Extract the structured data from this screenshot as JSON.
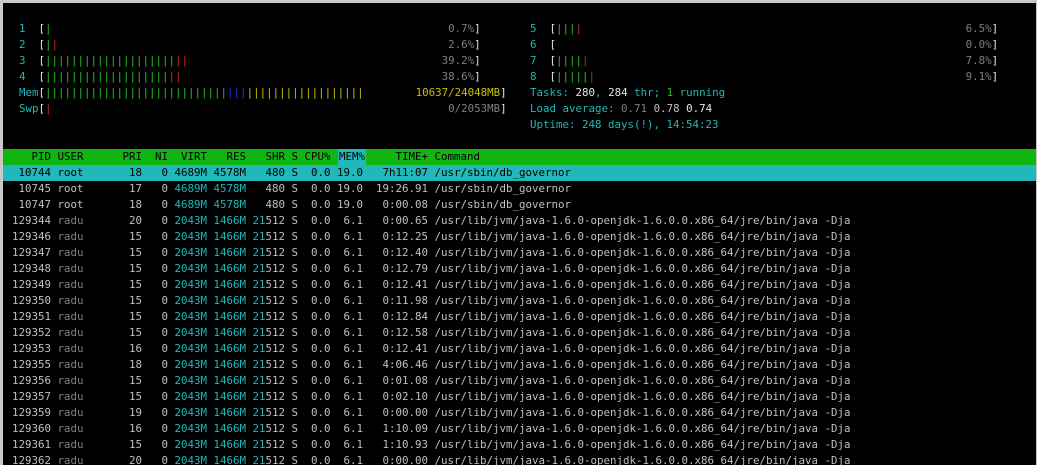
{
  "cpus": [
    {
      "id": "1",
      "bars": [
        {
          "c": "g",
          "n": 1
        }
      ],
      "pct": "0.7%"
    },
    {
      "id": "2",
      "bars": [
        {
          "c": "g",
          "n": 1
        },
        {
          "c": "r",
          "n": 1
        }
      ],
      "pct": "2.6%"
    },
    {
      "id": "3",
      "bars": [
        {
          "c": "g",
          "n": 20
        },
        {
          "c": "r",
          "n": 2
        }
      ],
      "pct": "39.2%"
    },
    {
      "id": "4",
      "bars": [
        {
          "c": "g",
          "n": 19
        },
        {
          "c": "r",
          "n": 2
        }
      ],
      "pct": "38.6%"
    },
    {
      "id": "5",
      "bars": [
        {
          "c": "g",
          "n": 3
        },
        {
          "c": "r",
          "n": 1
        }
      ],
      "pct": "6.5%"
    },
    {
      "id": "6",
      "bars": [],
      "pct": "0.0%"
    },
    {
      "id": "7",
      "bars": [
        {
          "c": "g",
          "n": 4
        },
        {
          "c": "r",
          "n": 1
        }
      ],
      "pct": "7.8%"
    },
    {
      "id": "8",
      "bars": [
        {
          "c": "g",
          "n": 5
        },
        {
          "c": "r",
          "n": 1
        }
      ],
      "pct": "9.1%"
    }
  ],
  "mem": {
    "label": "Mem",
    "bars": [
      {
        "c": "g",
        "n": 28
      },
      {
        "c": "bl",
        "n": 3
      },
      {
        "c": "ye",
        "n": 18
      }
    ],
    "value": "10637/24048MB"
  },
  "swp": {
    "label": "Swp",
    "bars": [
      {
        "c": "r",
        "n": 1
      }
    ],
    "value": "0/2053MB"
  },
  "tasks": {
    "label": "Tasks:",
    "count": "280",
    "thr": "284",
    "running": "1"
  },
  "load": {
    "label": "Load average:",
    "l1": "0.71",
    "l5": "0.78",
    "l15": "0.74"
  },
  "uptime": {
    "label": "Uptime:",
    "value": "248 days(!), 14:54:23"
  },
  "columns": {
    "pid": "PID",
    "user": "USER",
    "pri": "PRI",
    "ni": "NI",
    "virt": "VIRT",
    "res": "RES",
    "shr": "SHR",
    "s": "S",
    "cpu": "CPU%",
    "mem": "MEM%",
    "time": "TIME+",
    "cmd": "Command"
  },
  "processes": [
    {
      "pid": "10744",
      "user": "root",
      "pri": "18",
      "ni": "0",
      "virt": "4689M",
      "res": "4578M",
      "shr": "480",
      "s": "S",
      "cpu": "0.0",
      "mem": "19.0",
      "time": "7h11:07",
      "cmd": "/usr/sbin/db_governor"
    },
    {
      "pid": "10745",
      "user": "root",
      "pri": "17",
      "ni": "0",
      "virt": "4689M",
      "res": "4578M",
      "shr": "480",
      "s": "S",
      "cpu": "0.0",
      "mem": "19.0",
      "time": "19:26.91",
      "cmd": "/usr/sbin/db_governor"
    },
    {
      "pid": "10747",
      "user": "root",
      "pri": "18",
      "ni": "0",
      "virt": "4689M",
      "res": "4578M",
      "shr": "480",
      "s": "S",
      "cpu": "0.0",
      "mem": "19.0",
      "time": "0:00.08",
      "cmd": "/usr/sbin/db_governor"
    },
    {
      "pid": "129344",
      "user": "radu",
      "pri": "20",
      "ni": "0",
      "virt": "2043M",
      "res": "1466M",
      "shr": "21512",
      "s": "S",
      "cpu": "0.0",
      "mem": "6.1",
      "time": "0:00.65",
      "cmd": "/usr/lib/jvm/java-1.6.0-openjdk-1.6.0.0.x86_64/jre/bin/java -Dja"
    },
    {
      "pid": "129346",
      "user": "radu",
      "pri": "15",
      "ni": "0",
      "virt": "2043M",
      "res": "1466M",
      "shr": "21512",
      "s": "S",
      "cpu": "0.0",
      "mem": "6.1",
      "time": "0:12.25",
      "cmd": "/usr/lib/jvm/java-1.6.0-openjdk-1.6.0.0.x86_64/jre/bin/java -Dja"
    },
    {
      "pid": "129347",
      "user": "radu",
      "pri": "15",
      "ni": "0",
      "virt": "2043M",
      "res": "1466M",
      "shr": "21512",
      "s": "S",
      "cpu": "0.0",
      "mem": "6.1",
      "time": "0:12.40",
      "cmd": "/usr/lib/jvm/java-1.6.0-openjdk-1.6.0.0.x86_64/jre/bin/java -Dja"
    },
    {
      "pid": "129348",
      "user": "radu",
      "pri": "15",
      "ni": "0",
      "virt": "2043M",
      "res": "1466M",
      "shr": "21512",
      "s": "S",
      "cpu": "0.0",
      "mem": "6.1",
      "time": "0:12.79",
      "cmd": "/usr/lib/jvm/java-1.6.0-openjdk-1.6.0.0.x86_64/jre/bin/java -Dja"
    },
    {
      "pid": "129349",
      "user": "radu",
      "pri": "15",
      "ni": "0",
      "virt": "2043M",
      "res": "1466M",
      "shr": "21512",
      "s": "S",
      "cpu": "0.0",
      "mem": "6.1",
      "time": "0:12.41",
      "cmd": "/usr/lib/jvm/java-1.6.0-openjdk-1.6.0.0.x86_64/jre/bin/java -Dja"
    },
    {
      "pid": "129350",
      "user": "radu",
      "pri": "15",
      "ni": "0",
      "virt": "2043M",
      "res": "1466M",
      "shr": "21512",
      "s": "S",
      "cpu": "0.0",
      "mem": "6.1",
      "time": "0:11.98",
      "cmd": "/usr/lib/jvm/java-1.6.0-openjdk-1.6.0.0.x86_64/jre/bin/java -Dja"
    },
    {
      "pid": "129351",
      "user": "radu",
      "pri": "15",
      "ni": "0",
      "virt": "2043M",
      "res": "1466M",
      "shr": "21512",
      "s": "S",
      "cpu": "0.0",
      "mem": "6.1",
      "time": "0:12.84",
      "cmd": "/usr/lib/jvm/java-1.6.0-openjdk-1.6.0.0.x86_64/jre/bin/java -Dja"
    },
    {
      "pid": "129352",
      "user": "radu",
      "pri": "15",
      "ni": "0",
      "virt": "2043M",
      "res": "1466M",
      "shr": "21512",
      "s": "S",
      "cpu": "0.0",
      "mem": "6.1",
      "time": "0:12.58",
      "cmd": "/usr/lib/jvm/java-1.6.0-openjdk-1.6.0.0.x86_64/jre/bin/java -Dja"
    },
    {
      "pid": "129353",
      "user": "radu",
      "pri": "16",
      "ni": "0",
      "virt": "2043M",
      "res": "1466M",
      "shr": "21512",
      "s": "S",
      "cpu": "0.0",
      "mem": "6.1",
      "time": "0:12.41",
      "cmd": "/usr/lib/jvm/java-1.6.0-openjdk-1.6.0.0.x86_64/jre/bin/java -Dja"
    },
    {
      "pid": "129355",
      "user": "radu",
      "pri": "18",
      "ni": "0",
      "virt": "2043M",
      "res": "1466M",
      "shr": "21512",
      "s": "S",
      "cpu": "0.0",
      "mem": "6.1",
      "time": "4:06.46",
      "cmd": "/usr/lib/jvm/java-1.6.0-openjdk-1.6.0.0.x86_64/jre/bin/java -Dja"
    },
    {
      "pid": "129356",
      "user": "radu",
      "pri": "15",
      "ni": "0",
      "virt": "2043M",
      "res": "1466M",
      "shr": "21512",
      "s": "S",
      "cpu": "0.0",
      "mem": "6.1",
      "time": "0:01.08",
      "cmd": "/usr/lib/jvm/java-1.6.0-openjdk-1.6.0.0.x86_64/jre/bin/java -Dja"
    },
    {
      "pid": "129357",
      "user": "radu",
      "pri": "15",
      "ni": "0",
      "virt": "2043M",
      "res": "1466M",
      "shr": "21512",
      "s": "S",
      "cpu": "0.0",
      "mem": "6.1",
      "time": "0:02.10",
      "cmd": "/usr/lib/jvm/java-1.6.0-openjdk-1.6.0.0.x86_64/jre/bin/java -Dja"
    },
    {
      "pid": "129359",
      "user": "radu",
      "pri": "19",
      "ni": "0",
      "virt": "2043M",
      "res": "1466M",
      "shr": "21512",
      "s": "S",
      "cpu": "0.0",
      "mem": "6.1",
      "time": "0:00.00",
      "cmd": "/usr/lib/jvm/java-1.6.0-openjdk-1.6.0.0.x86_64/jre/bin/java -Dja"
    },
    {
      "pid": "129360",
      "user": "radu",
      "pri": "16",
      "ni": "0",
      "virt": "2043M",
      "res": "1466M",
      "shr": "21512",
      "s": "S",
      "cpu": "0.0",
      "mem": "6.1",
      "time": "1:10.09",
      "cmd": "/usr/lib/jvm/java-1.6.0-openjdk-1.6.0.0.x86_64/jre/bin/java -Dja"
    },
    {
      "pid": "129361",
      "user": "radu",
      "pri": "15",
      "ni": "0",
      "virt": "2043M",
      "res": "1466M",
      "shr": "21512",
      "s": "S",
      "cpu": "0.0",
      "mem": "6.1",
      "time": "1:10.93",
      "cmd": "/usr/lib/jvm/java-1.6.0-openjdk-1.6.0.0.x86_64/jre/bin/java -Dja"
    },
    {
      "pid": "129362",
      "user": "radu",
      "pri": "20",
      "ni": "0",
      "virt": "2043M",
      "res": "1466M",
      "shr": "21512",
      "s": "S",
      "cpu": "0.0",
      "mem": "6.1",
      "time": "0:00.00",
      "cmd": "/usr/lib/jvm/java-1.6.0-openjdk-1.6.0.0.x86_64/jre/bin/java -Dja"
    }
  ],
  "selected_index": 0,
  "colors": {
    "accent": "#20b8b8",
    "header_bg": "#11b511",
    "meter_green": "#24c024",
    "meter_red": "#c02828",
    "meter_blue": "#2b2bd0",
    "meter_yellow": "#c8c000"
  }
}
